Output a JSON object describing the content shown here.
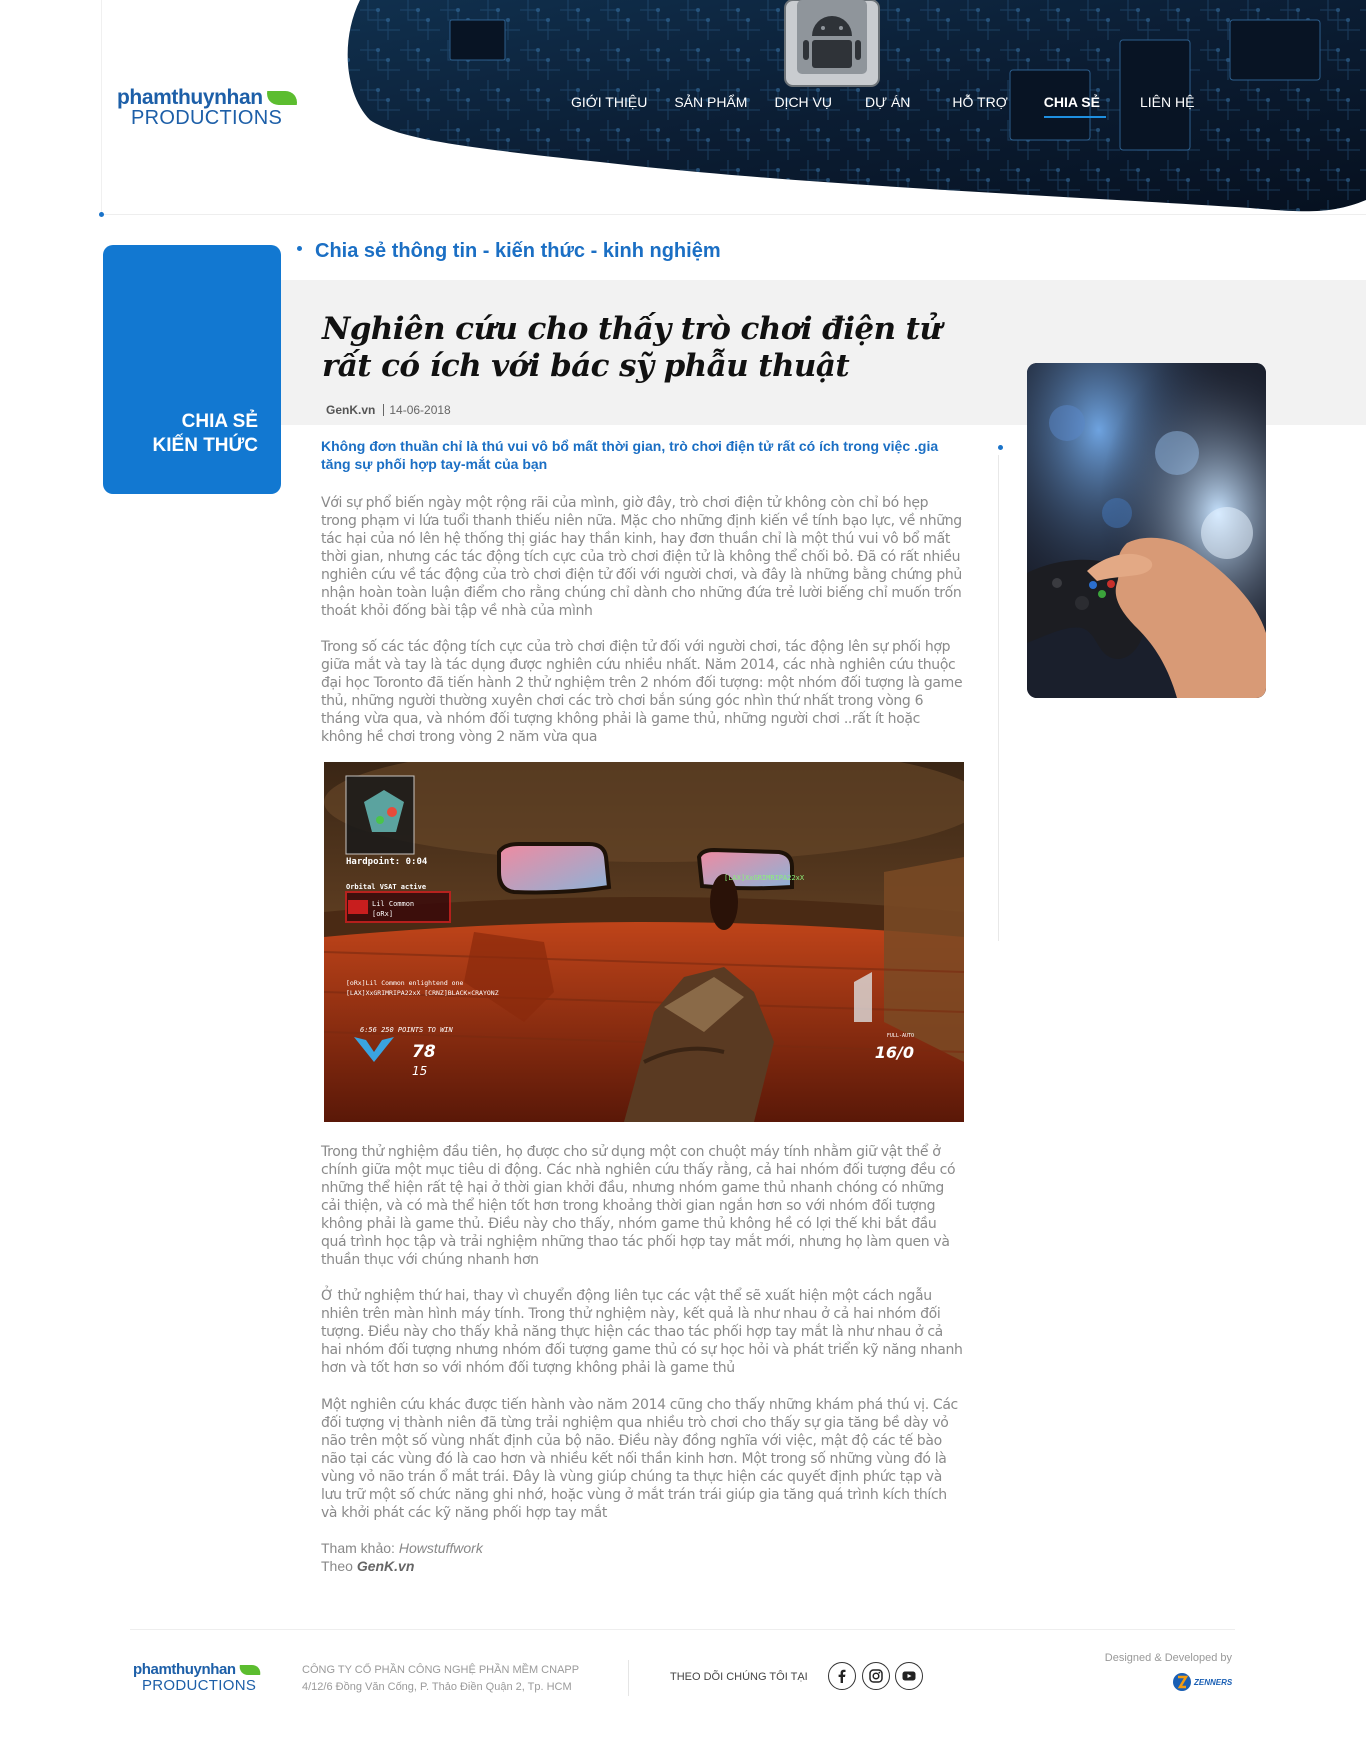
{
  "brand": {
    "name_top": "phamthuynhan",
    "name_bottom": "PRODUCTIONS"
  },
  "nav": {
    "items": [
      {
        "label": "GIỚI THIỆU"
      },
      {
        "label": "SẢN PHẨM"
      },
      {
        "label": "DỊCH VỤ"
      },
      {
        "label": "DỰ ÁN"
      },
      {
        "label": "HỖ TRỢ"
      },
      {
        "label": "CHIA SẺ"
      },
      {
        "label": "LIÊN HỆ"
      }
    ],
    "active": "CHIA SẺ"
  },
  "category": {
    "line1": "CHIA SẺ",
    "line2": "KIẾN THỨC"
  },
  "section_title": "Chia sẻ thông tin - kiến thức - kinh nghiệm",
  "article": {
    "title": "Nghiên cứu cho thấy trò chơi điện tử rất có ích với bác sỹ phẫu thuật",
    "source": "GenK.vn",
    "date": "14-06-2018",
    "sapo": "Không đơn thuần chỉ là thú vui vô bổ mất thời gian, trò chơi điện tử rất có ích trong việc .gia tăng sự phối hợp tay-mắt của bạn",
    "paragraphs": [
      "Với sự phổ biến ngày một rộng rãi của mình, giờ đây, trò chơi điện tử không còn chỉ bó hẹp trong phạm vi lứa tuổi thanh thiếu niên nữa. Mặc cho những định kiến về tính bạo lực, về những tác hại của nó lên hệ thống thị giác hay thần kinh, hay đơn thuần chỉ là một thú vui vô bổ mất thời gian, nhưng các tác động tích cực của trò chơi điện tử là không thể chối bỏ. Đã có rất nhiều nghiên cứu về tác động của trò chơi điện tử đối với người chơi, và đây là những bằng chứng phủ nhận hoàn toàn luận điểm cho rằng chúng chỉ dành cho những đứa trẻ lười biếng chỉ muốn trốn thoát khỏi đống bài tập về nhà của mình",
      "Trong số các tác động tích cực của trò chơi điện tử đối với người chơi, tác động lên sự phối hợp giữa mắt và tay là tác dụng được nghiên cứu nhiều nhất. Năm 2014, các nhà nghiên cứu thuộc đại học Toronto đã tiến hành 2 thử nghiệm trên 2 nhóm đối tượng: một nhóm đối tượng là game thủ, những người thường xuyên chơi các trò chơi bắn súng góc nhìn thứ nhất trong vòng 6 tháng vừa qua, và nhóm đối tượng không phải là game thủ, những người chơi ..rất ít hoặc không hề chơi trong vòng 2 năm vừa qua",
      "Trong thử nghiệm đầu tiên, họ được cho sử dụng một con chuột máy tính nhằm giữ vật thể ở chính giữa một mục tiêu di động. Các nhà nghiên cứu thấy rằng, cả hai nhóm đối tượng đều có những thể hiện rất tệ hại ở thời gian khởi đầu, nhưng nhóm game thủ nhanh chóng có những cải thiện, và có mà thể hiện tốt hơn trong khoảng thời gian ngắn hơn so với nhóm đối tượng không phải là game thủ. Điều này cho thấy, nhóm game thủ không hề có lợi thế khi bắt đầu quá trình học tập và trải nghiệm những thao tác phối hợp tay mắt mới, nhưng họ làm quen và thuần thục với chúng nhanh hơn",
      "Ở thử nghiệm thứ hai, thay vì chuyển động liên tục các vật thể sẽ xuất hiện một cách ngẫu nhiên trên màn hình máy tính. Trong thử nghiệm này, kết quả là như nhau ở cả hai nhóm đối tượng. Điều này cho thấy khả năng thực hiện các thao tác phối hợp tay mắt là như nhau ở cả hai nhóm đối tượng nhưng nhóm đối tượng game thủ có sự học hỏi và phát triển kỹ năng nhanh hơn và tốt hơn so với nhóm đối tượng không phải là game thủ",
      "Một nghiên cứu khác được tiến hành vào năm 2014 cũng cho thấy những khám phá thú vị. Các đối tượng vị thành niên đã từng trải nghiệm qua nhiều trò chơi cho thấy sự gia tăng bề dày vỏ não trên một số vùng nhất định của bộ não. Điều này đồng nghĩa với việc, mật độ các tế bào não tại các vùng đó là cao hơn và nhiều kết nối thần kinh hơn. Một trong số những vùng đó là vùng vỏ não trán ổ mắt trái. Đây là vùng giúp chúng ta thực hiện các quyết định phức tạp và lưu trữ một số chức năng ghi nhớ, hoặc vùng ở mắt trán trái giúp gia tăng quá trình kích thích và khởi phát các kỹ năng phối hợp tay mắt"
    ],
    "reference_label": "Tham khảo: ",
    "reference_source": "Howstuffwork",
    "via_label": "Theo ",
    "via_source": "GenK.vn"
  },
  "game_hud": {
    "hardpoint": "Hardpoint: 0:04",
    "killstreak": "Orbital VSAT active",
    "player": "Lil Common",
    "tag": "[oRx]",
    "feed1": "[oRx]Lil Common   enlightend one",
    "feed2": "[LAX]XxGRIMRIPA22xX  [CRNZ]BLACK×CRAYONZ",
    "nametag": "[LAX]XxGRIMRIPA22xX",
    "time_points": "6:56  250 POINTS TO WIN",
    "score_us": "78",
    "score_them": "15",
    "ammo": "16/0",
    "fire_mode": "FULL-AUTO"
  },
  "footer": {
    "company": "CÔNG TY CỔ PHẦN CÔNG NGHỆ PHẦN MỀM CNAPP",
    "address": "4/12/6 Đồng Văn Cống, P. Thảo Điền Quận 2, Tp. HCM",
    "follow": "THEO DÕI CHÚNG TÔI TẠI",
    "designed": "Designed & Developed by",
    "dev_brand": "ZENNERS"
  },
  "colors": {
    "primary": "#1278d1",
    "brand_blue": "#1d5fa8",
    "leaf_green": "#5cbd2f",
    "header_dark": "#0b1d33"
  },
  "icons": [
    "leaf-icon",
    "facebook-icon",
    "instagram-icon",
    "youtube-icon",
    "zenners-logo-icon"
  ]
}
